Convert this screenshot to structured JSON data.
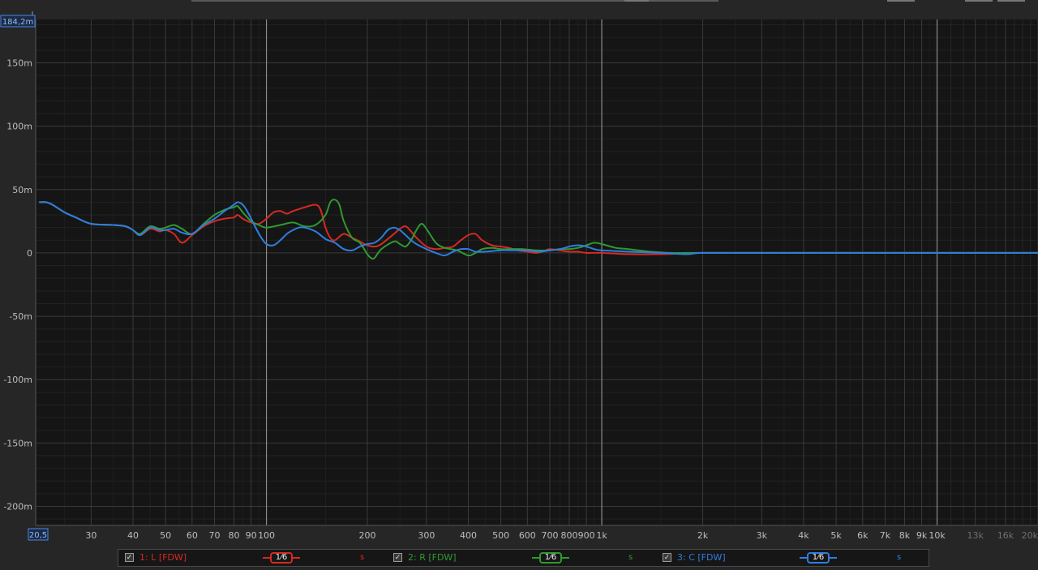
{
  "chart_data": {
    "type": "line",
    "title": "",
    "xlabel": "",
    "ylabel": "",
    "x_scale": "log",
    "xlim": [
      20.5,
      20000
    ],
    "ylim": [
      -215,
      184.2
    ],
    "grid": true,
    "top_readout": "184,2m",
    "bottom_readout": "20,5",
    "y_ticks": [
      {
        "value": 150,
        "label": "150m"
      },
      {
        "value": 100,
        "label": "100m"
      },
      {
        "value": 50,
        "label": "50m"
      },
      {
        "value": 0,
        "label": "0"
      },
      {
        "value": -50,
        "label": "-50m"
      },
      {
        "value": -100,
        "label": "-100m"
      },
      {
        "value": -150,
        "label": "-150m"
      },
      {
        "value": -200,
        "label": "-200m"
      }
    ],
    "x_ticks": [
      {
        "value": 30,
        "label": "30"
      },
      {
        "value": 40,
        "label": "40"
      },
      {
        "value": 50,
        "label": "50"
      },
      {
        "value": 60,
        "label": "60"
      },
      {
        "value": 70,
        "label": "70"
      },
      {
        "value": 80,
        "label": "80"
      },
      {
        "value": 90,
        "label": "90"
      },
      {
        "value": 100,
        "label": "100"
      },
      {
        "value": 200,
        "label": "200"
      },
      {
        "value": 300,
        "label": "300"
      },
      {
        "value": 400,
        "label": "400"
      },
      {
        "value": 500,
        "label": "500"
      },
      {
        "value": 600,
        "label": "600"
      },
      {
        "value": 700,
        "label": "700"
      },
      {
        "value": 800,
        "label": "800"
      },
      {
        "value": 900,
        "label": "900"
      },
      {
        "value": 1000,
        "label": "1k"
      },
      {
        "value": 2000,
        "label": "2k"
      },
      {
        "value": 3000,
        "label": "3k"
      },
      {
        "value": 4000,
        "label": "4k"
      },
      {
        "value": 5000,
        "label": "5k"
      },
      {
        "value": 6000,
        "label": "6k"
      },
      {
        "value": 7000,
        "label": "7k"
      },
      {
        "value": 8000,
        "label": "8k"
      },
      {
        "value": 9000,
        "label": "9k"
      },
      {
        "value": 10000,
        "label": "10k"
      },
      {
        "value": 13000,
        "label": "13k",
        "dim": true
      },
      {
        "value": 16000,
        "label": "16k",
        "dim": true
      },
      {
        "value": 20000,
        "label": "20k",
        "dim": true
      }
    ],
    "series": [
      {
        "name": "1: L [FDW]",
        "color": "#d42a22",
        "points": [
          [
            21,
            40
          ],
          [
            22,
            40
          ],
          [
            23,
            38
          ],
          [
            25,
            32
          ],
          [
            27,
            28
          ],
          [
            30,
            23
          ],
          [
            35,
            22
          ],
          [
            38,
            21
          ],
          [
            40,
            18
          ],
          [
            42,
            14
          ],
          [
            45,
            19
          ],
          [
            48,
            17
          ],
          [
            50,
            18
          ],
          [
            53,
            15
          ],
          [
            56,
            8
          ],
          [
            60,
            14
          ],
          [
            65,
            21
          ],
          [
            70,
            25
          ],
          [
            75,
            27
          ],
          [
            80,
            28
          ],
          [
            82,
            30
          ],
          [
            85,
            27
          ],
          [
            90,
            24
          ],
          [
            95,
            23
          ],
          [
            100,
            27
          ],
          [
            105,
            32
          ],
          [
            110,
            33
          ],
          [
            115,
            31
          ],
          [
            120,
            33
          ],
          [
            130,
            36
          ],
          [
            140,
            38
          ],
          [
            145,
            34
          ],
          [
            150,
            20
          ],
          [
            155,
            12
          ],
          [
            160,
            10
          ],
          [
            170,
            15
          ],
          [
            180,
            12
          ],
          [
            190,
            9
          ],
          [
            200,
            6
          ],
          [
            210,
            5
          ],
          [
            220,
            7
          ],
          [
            240,
            15
          ],
          [
            250,
            19
          ],
          [
            260,
            21
          ],
          [
            270,
            17
          ],
          [
            280,
            12
          ],
          [
            300,
            5
          ],
          [
            320,
            3
          ],
          [
            340,
            4
          ],
          [
            360,
            5
          ],
          [
            380,
            10
          ],
          [
            400,
            14
          ],
          [
            420,
            15
          ],
          [
            440,
            10
          ],
          [
            470,
            6
          ],
          [
            500,
            5
          ],
          [
            530,
            4
          ],
          [
            560,
            2
          ],
          [
            600,
            1
          ],
          [
            640,
            0
          ],
          [
            680,
            2
          ],
          [
            700,
            3
          ],
          [
            750,
            2
          ],
          [
            800,
            1
          ],
          [
            850,
            1
          ],
          [
            900,
            0
          ],
          [
            1000,
            0
          ],
          [
            1200,
            -1
          ],
          [
            1500,
            -1
          ],
          [
            2000,
            0
          ],
          [
            3000,
            0
          ],
          [
            5000,
            0
          ],
          [
            10000,
            0
          ],
          [
            20000,
            0
          ]
        ]
      },
      {
        "name": "2: R [FDW]",
        "color": "#2f9a2f",
        "points": [
          [
            21,
            40
          ],
          [
            22,
            40
          ],
          [
            23,
            38
          ],
          [
            25,
            32
          ],
          [
            27,
            28
          ],
          [
            30,
            23
          ],
          [
            35,
            22
          ],
          [
            38,
            21
          ],
          [
            40,
            18
          ],
          [
            42,
            15
          ],
          [
            45,
            21
          ],
          [
            48,
            19
          ],
          [
            50,
            20
          ],
          [
            53,
            22
          ],
          [
            56,
            19
          ],
          [
            60,
            15
          ],
          [
            65,
            23
          ],
          [
            70,
            30
          ],
          [
            75,
            34
          ],
          [
            80,
            36
          ],
          [
            82,
            37
          ],
          [
            85,
            32
          ],
          [
            90,
            25
          ],
          [
            95,
            22
          ],
          [
            100,
            20
          ],
          [
            110,
            22
          ],
          [
            120,
            24
          ],
          [
            130,
            21
          ],
          [
            140,
            22
          ],
          [
            150,
            30
          ],
          [
            155,
            40
          ],
          [
            160,
            42
          ],
          [
            165,
            38
          ],
          [
            170,
            25
          ],
          [
            180,
            12
          ],
          [
            190,
            8
          ],
          [
            200,
            -1
          ],
          [
            205,
            -4
          ],
          [
            210,
            -4
          ],
          [
            220,
            3
          ],
          [
            240,
            9
          ],
          [
            250,
            7
          ],
          [
            260,
            5
          ],
          [
            270,
            10
          ],
          [
            280,
            18
          ],
          [
            290,
            23
          ],
          [
            300,
            19
          ],
          [
            320,
            8
          ],
          [
            340,
            4
          ],
          [
            370,
            2
          ],
          [
            400,
            -2
          ],
          [
            420,
            0
          ],
          [
            440,
            3
          ],
          [
            470,
            4
          ],
          [
            500,
            3
          ],
          [
            540,
            3
          ],
          [
            580,
            3
          ],
          [
            640,
            2
          ],
          [
            700,
            2
          ],
          [
            750,
            3
          ],
          [
            800,
            3
          ],
          [
            850,
            4
          ],
          [
            900,
            6
          ],
          [
            950,
            8
          ],
          [
            1000,
            7
          ],
          [
            1100,
            4
          ],
          [
            1200,
            3
          ],
          [
            1400,
            1
          ],
          [
            1600,
            0
          ],
          [
            1800,
            0
          ],
          [
            2000,
            0
          ],
          [
            3000,
            0
          ],
          [
            5000,
            0
          ],
          [
            10000,
            0
          ],
          [
            20000,
            0
          ]
        ]
      },
      {
        "name": "3: C [FDW]",
        "color": "#2f7de0",
        "points": [
          [
            21,
            40
          ],
          [
            22,
            40
          ],
          [
            23,
            38
          ],
          [
            25,
            32
          ],
          [
            27,
            28
          ],
          [
            30,
            23
          ],
          [
            35,
            22
          ],
          [
            38,
            21
          ],
          [
            40,
            18
          ],
          [
            42,
            14
          ],
          [
            45,
            20
          ],
          [
            48,
            18
          ],
          [
            50,
            18
          ],
          [
            53,
            19
          ],
          [
            56,
            16
          ],
          [
            60,
            15
          ],
          [
            65,
            22
          ],
          [
            70,
            27
          ],
          [
            75,
            33
          ],
          [
            80,
            38
          ],
          [
            82,
            40
          ],
          [
            85,
            38
          ],
          [
            88,
            32
          ],
          [
            92,
            22
          ],
          [
            96,
            13
          ],
          [
            100,
            7
          ],
          [
            105,
            6
          ],
          [
            110,
            10
          ],
          [
            115,
            15
          ],
          [
            120,
            18
          ],
          [
            125,
            20
          ],
          [
            130,
            20
          ],
          [
            140,
            17
          ],
          [
            150,
            11
          ],
          [
            160,
            8
          ],
          [
            170,
            3
          ],
          [
            180,
            2
          ],
          [
            190,
            5
          ],
          [
            200,
            7
          ],
          [
            210,
            8
          ],
          [
            220,
            12
          ],
          [
            230,
            18
          ],
          [
            240,
            20
          ],
          [
            250,
            18
          ],
          [
            260,
            14
          ],
          [
            270,
            10
          ],
          [
            280,
            7
          ],
          [
            300,
            3
          ],
          [
            320,
            0
          ],
          [
            340,
            -2
          ],
          [
            360,
            1
          ],
          [
            380,
            3
          ],
          [
            400,
            3
          ],
          [
            420,
            1
          ],
          [
            450,
            1
          ],
          [
            500,
            2
          ],
          [
            550,
            2
          ],
          [
            600,
            2
          ],
          [
            650,
            1
          ],
          [
            700,
            2
          ],
          [
            750,
            3
          ],
          [
            800,
            5
          ],
          [
            850,
            6
          ],
          [
            900,
            5
          ],
          [
            950,
            3
          ],
          [
            1000,
            2
          ],
          [
            1200,
            1
          ],
          [
            1500,
            0
          ],
          [
            1800,
            -1
          ],
          [
            2000,
            0
          ],
          [
            3000,
            0
          ],
          [
            5000,
            0
          ],
          [
            10000,
            0
          ],
          [
            20000,
            0
          ]
        ]
      }
    ]
  },
  "legend": [
    {
      "check": "✓",
      "name": "1: L [FDW]",
      "smoothing": "1⁄6",
      "unit": "s",
      "color": "#d42a22"
    },
    {
      "check": "✓",
      "name": "2: R [FDW]",
      "smoothing": "1⁄6",
      "unit": "s",
      "color": "#2f9a2f"
    },
    {
      "check": "✓",
      "name": "3: C [FDW]",
      "smoothing": "1⁄6",
      "unit": "s",
      "color": "#2f7de0"
    }
  ]
}
